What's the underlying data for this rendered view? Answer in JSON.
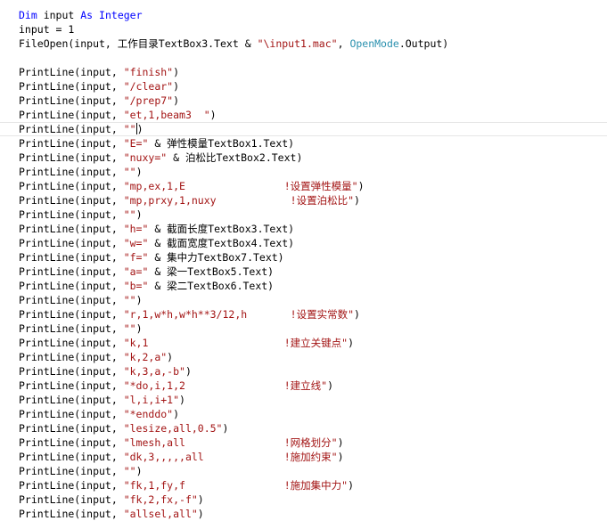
{
  "lines": [
    [
      {
        "t": "Dim",
        "c": "kw"
      },
      {
        "t": " input ",
        "c": "plain"
      },
      {
        "t": "As",
        "c": "kw"
      },
      {
        "t": " ",
        "c": "plain"
      },
      {
        "t": "Integer",
        "c": "kw"
      }
    ],
    [
      {
        "t": "input = 1",
        "c": "plain"
      }
    ],
    [
      {
        "t": "FileOpen(input, 工作目录TextBox3.Text & ",
        "c": "plain"
      },
      {
        "t": "\"\\input1.mac\"",
        "c": "str"
      },
      {
        "t": ", ",
        "c": "plain"
      },
      {
        "t": "OpenMode",
        "c": "type"
      },
      {
        "t": ".Output)",
        "c": "plain"
      }
    ],
    [],
    [
      {
        "t": "PrintLine(input, ",
        "c": "plain"
      },
      {
        "t": "\"finish\"",
        "c": "str"
      },
      {
        "t": ")",
        "c": "plain"
      }
    ],
    [
      {
        "t": "PrintLine(input, ",
        "c": "plain"
      },
      {
        "t": "\"/clear\"",
        "c": "str"
      },
      {
        "t": ")",
        "c": "plain"
      }
    ],
    [
      {
        "t": "PrintLine(input, ",
        "c": "plain"
      },
      {
        "t": "\"/prep7\"",
        "c": "str"
      },
      {
        "t": ")",
        "c": "plain"
      }
    ],
    [
      {
        "t": "PrintLine(input, ",
        "c": "plain"
      },
      {
        "t": "\"et,1,beam3  \"",
        "c": "str"
      },
      {
        "t": ")",
        "c": "plain"
      }
    ],
    [
      {
        "t": "PrintLine(input, ",
        "c": "plain"
      },
      {
        "t": "\"\"",
        "c": "str"
      },
      {
        "t": ")",
        "c": "plain"
      }
    ],
    [
      {
        "t": "PrintLine(input, ",
        "c": "plain"
      },
      {
        "t": "\"E=\"",
        "c": "str"
      },
      {
        "t": " & 弹性模量TextBox1.Text)",
        "c": "plain"
      }
    ],
    [
      {
        "t": "PrintLine(input, ",
        "c": "plain"
      },
      {
        "t": "\"nuxy=\"",
        "c": "str"
      },
      {
        "t": " & 泊松比TextBox2.Text)",
        "c": "plain"
      }
    ],
    [
      {
        "t": "PrintLine(input, ",
        "c": "plain"
      },
      {
        "t": "\"\"",
        "c": "str"
      },
      {
        "t": ")",
        "c": "plain"
      }
    ],
    [
      {
        "t": "PrintLine(input, ",
        "c": "plain"
      },
      {
        "t": "\"mp,ex,1,E                !设置弹性模量\"",
        "c": "str"
      },
      {
        "t": ")",
        "c": "plain"
      }
    ],
    [
      {
        "t": "PrintLine(input, ",
        "c": "plain"
      },
      {
        "t": "\"mp,prxy,1,nuxy            !设置泊松比\"",
        "c": "str"
      },
      {
        "t": ")",
        "c": "plain"
      }
    ],
    [
      {
        "t": "PrintLine(input, ",
        "c": "plain"
      },
      {
        "t": "\"\"",
        "c": "str"
      },
      {
        "t": ")",
        "c": "plain"
      }
    ],
    [
      {
        "t": "PrintLine(input, ",
        "c": "plain"
      },
      {
        "t": "\"h=\"",
        "c": "str"
      },
      {
        "t": " & 截面长度TextBox3.Text)",
        "c": "plain"
      }
    ],
    [
      {
        "t": "PrintLine(input, ",
        "c": "plain"
      },
      {
        "t": "\"w=\"",
        "c": "str"
      },
      {
        "t": " & 截面宽度TextBox4.Text)",
        "c": "plain"
      }
    ],
    [
      {
        "t": "PrintLine(input, ",
        "c": "plain"
      },
      {
        "t": "\"f=\"",
        "c": "str"
      },
      {
        "t": " & 集中力TextBox7.Text)",
        "c": "plain"
      }
    ],
    [
      {
        "t": "PrintLine(input, ",
        "c": "plain"
      },
      {
        "t": "\"a=\"",
        "c": "str"
      },
      {
        "t": " & 梁一TextBox5.Text)",
        "c": "plain"
      }
    ],
    [
      {
        "t": "PrintLine(input, ",
        "c": "plain"
      },
      {
        "t": "\"b=\"",
        "c": "str"
      },
      {
        "t": " & 梁二TextBox6.Text)",
        "c": "plain"
      }
    ],
    [
      {
        "t": "PrintLine(input, ",
        "c": "plain"
      },
      {
        "t": "\"\"",
        "c": "str"
      },
      {
        "t": ")",
        "c": "plain"
      }
    ],
    [
      {
        "t": "PrintLine(input, ",
        "c": "plain"
      },
      {
        "t": "\"r,1,w*h,w*h**3/12,h       !设置实常数\"",
        "c": "str"
      },
      {
        "t": ")",
        "c": "plain"
      }
    ],
    [
      {
        "t": "PrintLine(input, ",
        "c": "plain"
      },
      {
        "t": "\"\"",
        "c": "str"
      },
      {
        "t": ")",
        "c": "plain"
      }
    ],
    [
      {
        "t": "PrintLine(input, ",
        "c": "plain"
      },
      {
        "t": "\"k,1                      !建立关键点\"",
        "c": "str"
      },
      {
        "t": ")",
        "c": "plain"
      }
    ],
    [
      {
        "t": "PrintLine(input, ",
        "c": "plain"
      },
      {
        "t": "\"k,2,a\"",
        "c": "str"
      },
      {
        "t": ")",
        "c": "plain"
      }
    ],
    [
      {
        "t": "PrintLine(input, ",
        "c": "plain"
      },
      {
        "t": "\"k,3,a,-b\"",
        "c": "str"
      },
      {
        "t": ")",
        "c": "plain"
      }
    ],
    [
      {
        "t": "PrintLine(input, ",
        "c": "plain"
      },
      {
        "t": "\"*do,i,1,2                !建立线\"",
        "c": "str"
      },
      {
        "t": ")",
        "c": "plain"
      }
    ],
    [
      {
        "t": "PrintLine(input, ",
        "c": "plain"
      },
      {
        "t": "\"l,i,i+1\"",
        "c": "str"
      },
      {
        "t": ")",
        "c": "plain"
      }
    ],
    [
      {
        "t": "PrintLine(input, ",
        "c": "plain"
      },
      {
        "t": "\"*enddo\"",
        "c": "str"
      },
      {
        "t": ")",
        "c": "plain"
      }
    ],
    [
      {
        "t": "PrintLine(input, ",
        "c": "plain"
      },
      {
        "t": "\"lesize,all,0.5\"",
        "c": "str"
      },
      {
        "t": ")",
        "c": "plain"
      }
    ],
    [
      {
        "t": "PrintLine(input, ",
        "c": "plain"
      },
      {
        "t": "\"lmesh,all                !网格划分\"",
        "c": "str"
      },
      {
        "t": ")",
        "c": "plain"
      }
    ],
    [
      {
        "t": "PrintLine(input, ",
        "c": "plain"
      },
      {
        "t": "\"dk,3,,,,,all             !施加约束\"",
        "c": "str"
      },
      {
        "t": ")",
        "c": "plain"
      }
    ],
    [
      {
        "t": "PrintLine(input, ",
        "c": "plain"
      },
      {
        "t": "\"\"",
        "c": "str"
      },
      {
        "t": ")",
        "c": "plain"
      }
    ],
    [
      {
        "t": "PrintLine(input, ",
        "c": "plain"
      },
      {
        "t": "\"fk,1,fy,f                !施加集中力\"",
        "c": "str"
      },
      {
        "t": ")",
        "c": "plain"
      }
    ],
    [
      {
        "t": "PrintLine(input, ",
        "c": "plain"
      },
      {
        "t": "\"fk,2,fx,-f\"",
        "c": "str"
      },
      {
        "t": ")",
        "c": "plain"
      }
    ],
    [
      {
        "t": "PrintLine(input, ",
        "c": "plain"
      },
      {
        "t": "\"allsel,all\"",
        "c": "str"
      },
      {
        "t": ")",
        "c": "plain"
      }
    ]
  ]
}
